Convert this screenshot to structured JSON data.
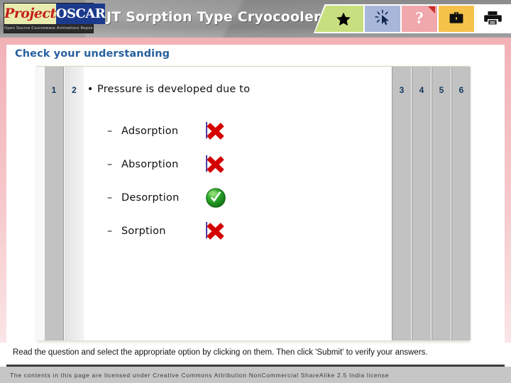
{
  "header": {
    "logo": {
      "word1": "Project",
      "word2": "OSCAR",
      "tagline": "Open Source Courseware Animations Repository"
    },
    "title": "JT Sorption Type Cryocooler",
    "buttons": [
      {
        "name": "favorite",
        "icon": "star-icon",
        "glyph": "★",
        "bg": "#c8df7f"
      },
      {
        "name": "interact",
        "icon": "click-cursor-icon",
        "glyph": "",
        "bg": "#a8b6da"
      },
      {
        "name": "help",
        "icon": "question-mark-icon",
        "glyph": "?",
        "bg": "#f0a8ac"
      },
      {
        "name": "resources",
        "icon": "briefcase-icon",
        "glyph": "",
        "bg": "#f5c24a"
      },
      {
        "name": "print",
        "icon": "printer-icon",
        "glyph": "",
        "bg": "#ffffff"
      }
    ]
  },
  "slide": {
    "section_title": "Check your understanding",
    "tabs_left": [
      "1",
      "2"
    ],
    "tabs_right": [
      "3",
      "4",
      "5",
      "6"
    ],
    "question": {
      "bullet": "•",
      "text": "Pressure is developed due to"
    },
    "options": [
      {
        "dash": "–",
        "label": "Adsorption",
        "mark": "cross",
        "mark_icon": "red-cross-icon"
      },
      {
        "dash": "–",
        "label": "Absorption",
        "mark": "cross",
        "mark_icon": "red-cross-icon"
      },
      {
        "dash": "–",
        "label": "Desorption",
        "mark": "check",
        "mark_icon": "green-check-icon"
      },
      {
        "dash": "–",
        "label": "Sorption",
        "mark": "cross",
        "mark_icon": "red-cross-icon"
      }
    ]
  },
  "footer": {
    "instruction": "Read the question and select the appropriate option by clicking on them. Then click 'Submit' to verify your answers.",
    "license": "The contents in this page are licensed under Creative Commons Attribution NonCommercial ShareAlike 2.5 India license"
  },
  "colors": {
    "accent_blue": "#28609f",
    "frame_pink": "#f2b2b6",
    "correct_green": "#1f9b20",
    "wrong_red": "#d40000"
  }
}
